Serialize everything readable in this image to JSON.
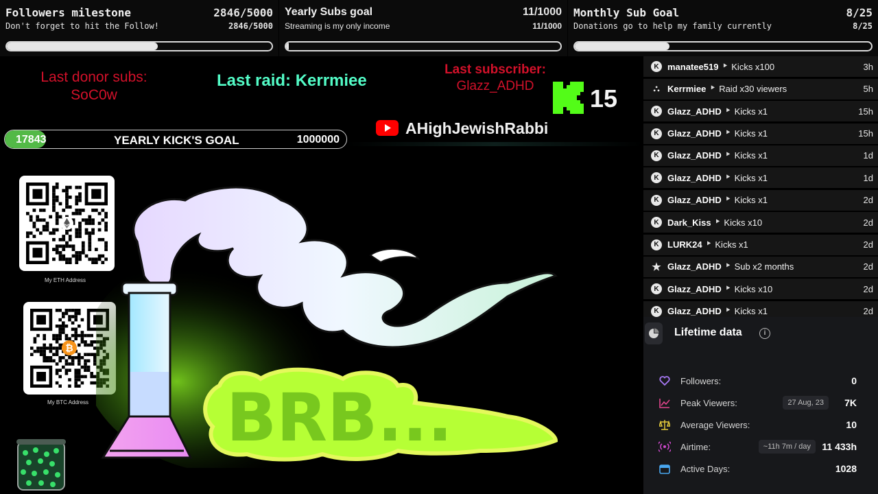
{
  "goals": [
    {
      "title": "Followers milestone",
      "count": "2846/5000",
      "subtitle": "Don't forget to hit the Follow!",
      "count2": "2846/5000",
      "progress": 0.5692
    },
    {
      "title": "Yearly Subs goal",
      "count": "11/1000",
      "subtitle": "Streaming is my only income",
      "count2": "11/1000",
      "progress": 0.011
    },
    {
      "title": "Monthly Sub Goal",
      "count": "8/25",
      "subtitle": "Donations go to help my family currently",
      "count2": "8/25",
      "progress": 0.32
    }
  ],
  "overlay": {
    "last_donor_label": "Last donor subs:",
    "last_donor_name": "SoC0w",
    "last_raid": "Last raid: Kerrmiee",
    "last_subscriber_label": "Last subscriber:",
    "last_subscriber_name": "Glazz_ADHD",
    "kick_count": "15",
    "yearly_kicks": {
      "current": "17843",
      "label": "YEARLY KICK'S GOAL",
      "target": "1000000",
      "progress": 0.0178
    },
    "youtube_channel": "AHighJewishRabbi",
    "eth_caption": "My ETH Address",
    "btc_caption": "My BTC Address",
    "brb_text": "BRB..."
  },
  "feed": [
    {
      "icon": "kick-icon",
      "user": "manatee519",
      "action": "Kicks x100",
      "time": "3h"
    },
    {
      "icon": "raid-icon",
      "user": "Kerrmiee",
      "action": "Raid x30 viewers",
      "time": "5h"
    },
    {
      "icon": "kick-icon",
      "user": "Glazz_ADHD",
      "action": "Kicks x1",
      "time": "15h"
    },
    {
      "icon": "kick-icon",
      "user": "Glazz_ADHD",
      "action": "Kicks x1",
      "time": "15h"
    },
    {
      "icon": "kick-icon",
      "user": "Glazz_ADHD",
      "action": "Kicks x1",
      "time": "1d"
    },
    {
      "icon": "kick-icon",
      "user": "Glazz_ADHD",
      "action": "Kicks x1",
      "time": "1d"
    },
    {
      "icon": "kick-icon",
      "user": "Glazz_ADHD",
      "action": "Kicks x1",
      "time": "2d"
    },
    {
      "icon": "kick-icon",
      "user": "Dark_Kiss",
      "action": "Kicks x10",
      "time": "2d"
    },
    {
      "icon": "kick-icon",
      "user": "LURK24",
      "action": "Kicks x1",
      "time": "2d"
    },
    {
      "icon": "star-icon",
      "user": "Glazz_ADHD",
      "action": "Sub x2 months",
      "time": "2d"
    },
    {
      "icon": "kick-icon",
      "user": "Glazz_ADHD",
      "action": "Kicks x10",
      "time": "2d"
    },
    {
      "icon": "kick-icon",
      "user": "Glazz_ADHD",
      "action": "Kicks x1",
      "time": "2d"
    }
  ],
  "lifetime": {
    "title": "Lifetime data",
    "rows": [
      {
        "icon": "heart-icon",
        "label": "Followers:",
        "pill": "",
        "value": "0"
      },
      {
        "icon": "peak-chart-icon",
        "label": "Peak Viewers:",
        "pill": "27 Aug, 23",
        "value": "7K"
      },
      {
        "icon": "average-scale-icon",
        "label": "Average Viewers:",
        "pill": "",
        "value": "10"
      },
      {
        "icon": "broadcast-icon",
        "label": "Airtime:",
        "pill": "~11h 7m / day",
        "value": "11 433h"
      },
      {
        "icon": "calendar-icon",
        "label": "Active Days:",
        "pill": "",
        "value": "1028"
      }
    ]
  },
  "colors": {
    "kick_green": "#53fc18",
    "raid_teal": "#53fcc7",
    "alert_red": "#d3112a",
    "youtube_red": "#ff0000",
    "lifetime_purple": "#a879f5"
  }
}
